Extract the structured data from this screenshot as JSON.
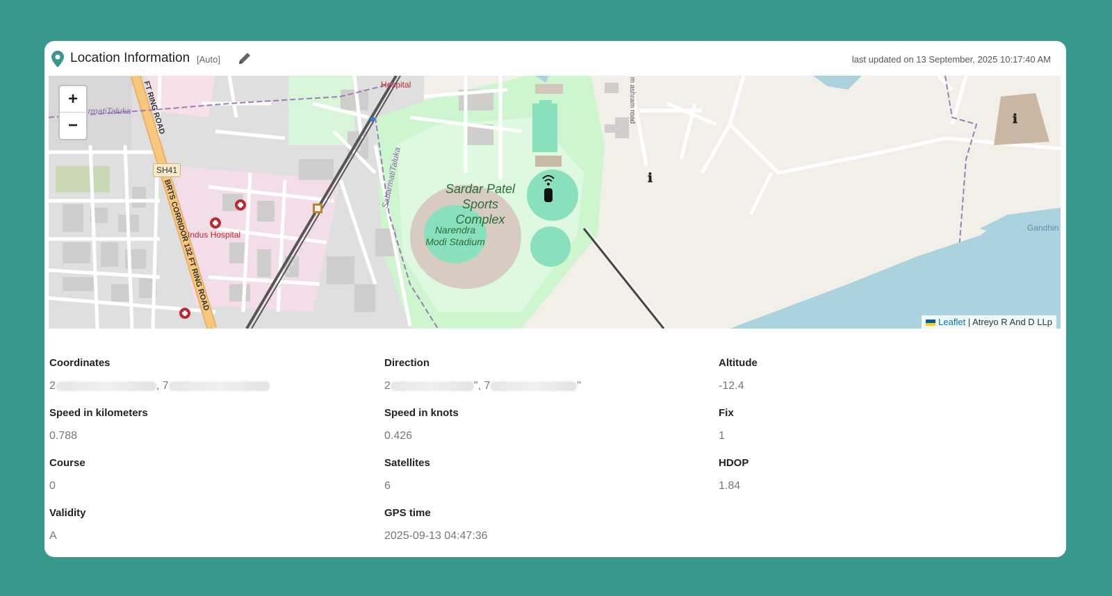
{
  "header": {
    "title": "Location Information",
    "mode_tag": "[Auto]",
    "last_updated": "last updated on 13 September, 2025 10:17:40 AM",
    "icons": {
      "pin": "location-pin-icon",
      "edit": "pencil-icon"
    }
  },
  "map": {
    "zoom_in": "+",
    "zoom_out": "−",
    "attribution_link": "Leaflet",
    "attribution_sep": " | ",
    "attribution_text": "Atreyo R And D LLp",
    "labels": {
      "stadium_complex": "Sardar Patel Sports Complex",
      "stadium": "Narendra Modi Stadium",
      "hospital_top": "Hospital",
      "hospital_indus": "Indus Hospital",
      "ring_road": "FT RING ROAD",
      "brts": "BRTS CORRIDOR 132 FT RING ROAD",
      "shield": "SH41",
      "taluka_left": "armatiTaluka",
      "taluka_mid": "SabarmatiTaluka",
      "ashram_road": "m ashram road",
      "gandhi": "Gandhin"
    },
    "colors": {
      "water": "#aad3df",
      "park": "#c8facc",
      "pitch": "#88e0be",
      "road_major": "#f7c77e",
      "residential": "#e0dfdf"
    }
  },
  "fields": {
    "coordinates": {
      "label": "Coordinates",
      "value_start": "2",
      "value_sep": ", 7",
      "value_end": ""
    },
    "direction": {
      "label": "Direction",
      "value_start": "2",
      "value_sep": "\", 7",
      "value_end": "\""
    },
    "altitude": {
      "label": "Altitude",
      "value": "-12.4"
    },
    "speed_km": {
      "label": "Speed in kilometers",
      "value": "0.788"
    },
    "speed_knots": {
      "label": "Speed in knots",
      "value": "0.426"
    },
    "fix": {
      "label": "Fix",
      "value": "1"
    },
    "course": {
      "label": "Course",
      "value": "0"
    },
    "satellites": {
      "label": "Satellites",
      "value": "6"
    },
    "hdop": {
      "label": "HDOP",
      "value": "1.84"
    },
    "validity": {
      "label": "Validity",
      "value": "A"
    },
    "gps_time": {
      "label": "GPS time",
      "value": "2025-09-13 04:47:36"
    }
  }
}
